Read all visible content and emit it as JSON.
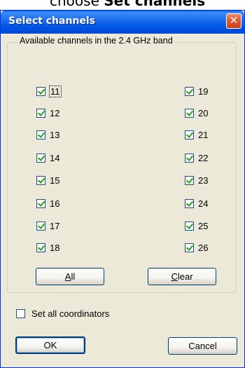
{
  "background_caption": {
    "prefix": "choose ",
    "bold": "Set channels"
  },
  "dialog": {
    "title": "Select channels",
    "close_glyph": "✕"
  },
  "group": {
    "legend": "Available channels in the 2.4 GHz band"
  },
  "channels_left": [
    {
      "label": "11",
      "checked": true
    },
    {
      "label": "12",
      "checked": true
    },
    {
      "label": "13",
      "checked": true
    },
    {
      "label": "14",
      "checked": true
    },
    {
      "label": "15",
      "checked": true
    },
    {
      "label": "16",
      "checked": true
    },
    {
      "label": "17",
      "checked": true
    },
    {
      "label": "18",
      "checked": true
    }
  ],
  "channels_right": [
    {
      "label": "19",
      "checked": true
    },
    {
      "label": "20",
      "checked": true
    },
    {
      "label": "21",
      "checked": true
    },
    {
      "label": "22",
      "checked": true
    },
    {
      "label": "23",
      "checked": true
    },
    {
      "label": "24",
      "checked": true
    },
    {
      "label": "25",
      "checked": true
    },
    {
      "label": "26",
      "checked": true
    }
  ],
  "buttons": {
    "all_mnemonic": "A",
    "all_rest": "ll",
    "clear_mnemonic": "C",
    "clear_rest": "lear",
    "ok": "OK",
    "cancel": "Cancel"
  },
  "set_all_coordinators": {
    "label": "Set all coordinators",
    "checked": false
  },
  "colors": {
    "titlebar": "#0055e5",
    "dialog_bg": "#ece9d8",
    "check_mark": "#21a121",
    "close_button": "#e0552e"
  }
}
